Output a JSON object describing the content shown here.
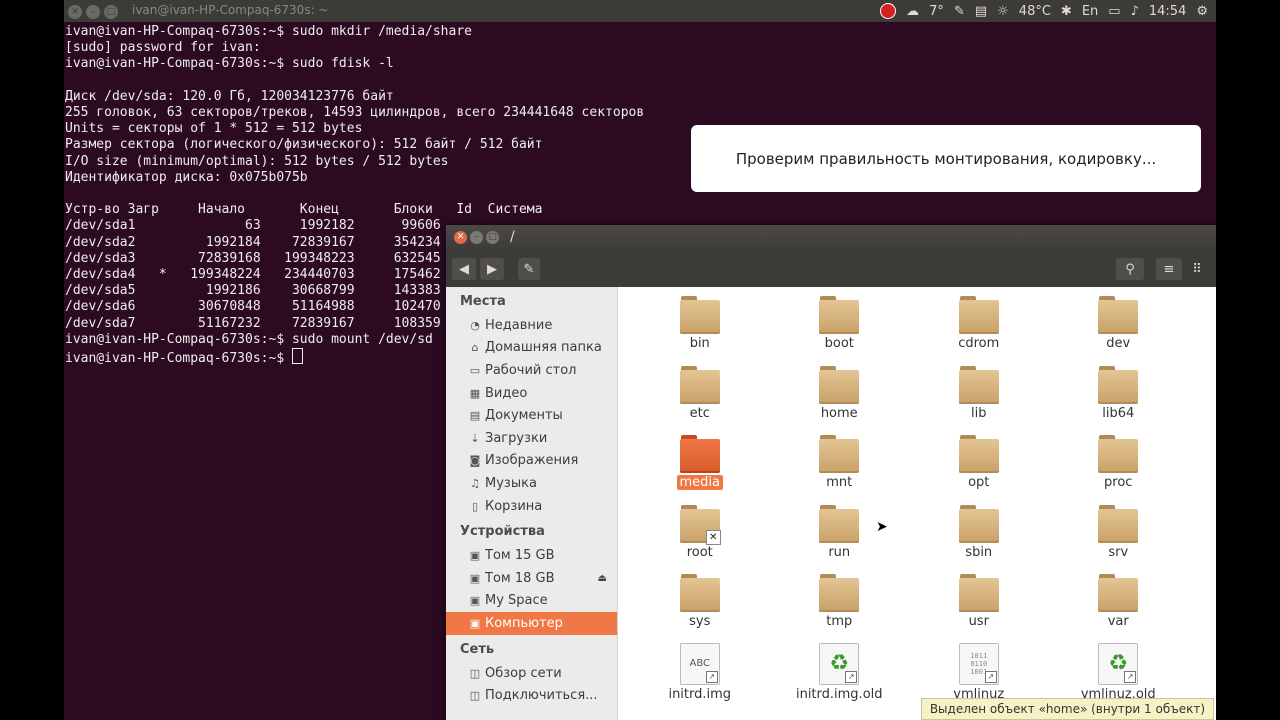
{
  "top_panel": {
    "window_title": "ivan@ivan-HP-Compaq-6730s: ~",
    "weather": "7°",
    "temperature": "48°C",
    "keyboard_layout": "En",
    "clock": "14:54"
  },
  "terminal": {
    "lines": [
      "ivan@ivan-HP-Compaq-6730s:~$ sudo mkdir /media/share",
      "[sudo] password for ivan:",
      "ivan@ivan-HP-Compaq-6730s:~$ sudo fdisk -l",
      "",
      "Диск /dev/sda: 120.0 Гб, 120034123776 байт",
      "255 головок, 63 секторов/треков, 14593 цилиндров, всего 234441648 секторов",
      "Units = секторы of 1 * 512 = 512 bytes",
      "Размер сектора (логического/физического): 512 байт / 512 байт",
      "I/O size (minimum/optimal): 512 bytes / 512 bytes",
      "Идентификатор диска: 0x075b075b",
      "",
      "Устр-во Загр     Начало       Конец       Блоки   Id  Система",
      "/dev/sda1              63     1992182      99606",
      "/dev/sda2         1992184    72839167     354234",
      "/dev/sda3        72839168   199348223     632545",
      "/dev/sda4   *   199348224   234440703     175462",
      "/dev/sda5         1992186    30668799     143383",
      "/dev/sda6        30670848    51164988     102470",
      "/dev/sda7        51167232    72839167     108359",
      "ivan@ivan-HP-Compaq-6730s:~$ sudo mount /dev/sd",
      "ivan@ivan-HP-Compaq-6730s:~$ "
    ]
  },
  "note": "Проверим правильность монтирования, кодировку...",
  "file_manager": {
    "path": "/",
    "sidebar": {
      "places_header": "Места",
      "places": [
        {
          "label": "Недавние",
          "icon": "clock-icon"
        },
        {
          "label": "Домашняя папка",
          "icon": "home-icon"
        },
        {
          "label": "Рабочий стол",
          "icon": "desktop-icon"
        },
        {
          "label": "Видео",
          "icon": "video-icon"
        },
        {
          "label": "Документы",
          "icon": "document-icon"
        },
        {
          "label": "Загрузки",
          "icon": "download-icon"
        },
        {
          "label": "Изображения",
          "icon": "camera-icon"
        },
        {
          "label": "Музыка",
          "icon": "music-icon"
        },
        {
          "label": "Корзина",
          "icon": "trash-icon"
        }
      ],
      "devices_header": "Устройства",
      "devices": [
        {
          "label": "Том 15 GB",
          "icon": "drive-icon"
        },
        {
          "label": "Том 18 GB",
          "icon": "drive-icon"
        },
        {
          "label": "My Space",
          "icon": "drive-icon"
        },
        {
          "label": "Компьютер",
          "icon": "computer-icon"
        }
      ],
      "network_header": "Сеть",
      "network": [
        {
          "label": "Обзор сети",
          "icon": "network-icon"
        },
        {
          "label": "Подключиться...",
          "icon": "connect-icon"
        }
      ]
    },
    "items": [
      {
        "name": "bin",
        "type": "folder"
      },
      {
        "name": "boot",
        "type": "folder"
      },
      {
        "name": "cdrom",
        "type": "folder"
      },
      {
        "name": "dev",
        "type": "folder"
      },
      {
        "name": "etc",
        "type": "folder"
      },
      {
        "name": "home",
        "type": "folder"
      },
      {
        "name": "lib",
        "type": "folder"
      },
      {
        "name": "lib64",
        "type": "folder"
      },
      {
        "name": "media",
        "type": "folder-selected"
      },
      {
        "name": "mnt",
        "type": "folder"
      },
      {
        "name": "opt",
        "type": "folder"
      },
      {
        "name": "proc",
        "type": "folder"
      },
      {
        "name": "root",
        "type": "folder-locked"
      },
      {
        "name": "run",
        "type": "folder"
      },
      {
        "name": "sbin",
        "type": "folder"
      },
      {
        "name": "srv",
        "type": "folder"
      },
      {
        "name": "sys",
        "type": "folder"
      },
      {
        "name": "tmp",
        "type": "folder"
      },
      {
        "name": "usr",
        "type": "folder"
      },
      {
        "name": "var",
        "type": "folder"
      },
      {
        "name": "initrd.img",
        "type": "file-text"
      },
      {
        "name": "initrd.img.old",
        "type": "file-archive"
      },
      {
        "name": "vmlinuz",
        "type": "file-binary"
      },
      {
        "name": "vmlinuz.old",
        "type": "file-archive"
      }
    ],
    "status": "Выделен объект «home» (внутри 1 объект)"
  },
  "colors": {
    "accent": "#f07746",
    "desktop": "#2c0a22",
    "panel": "#3c3b37"
  }
}
